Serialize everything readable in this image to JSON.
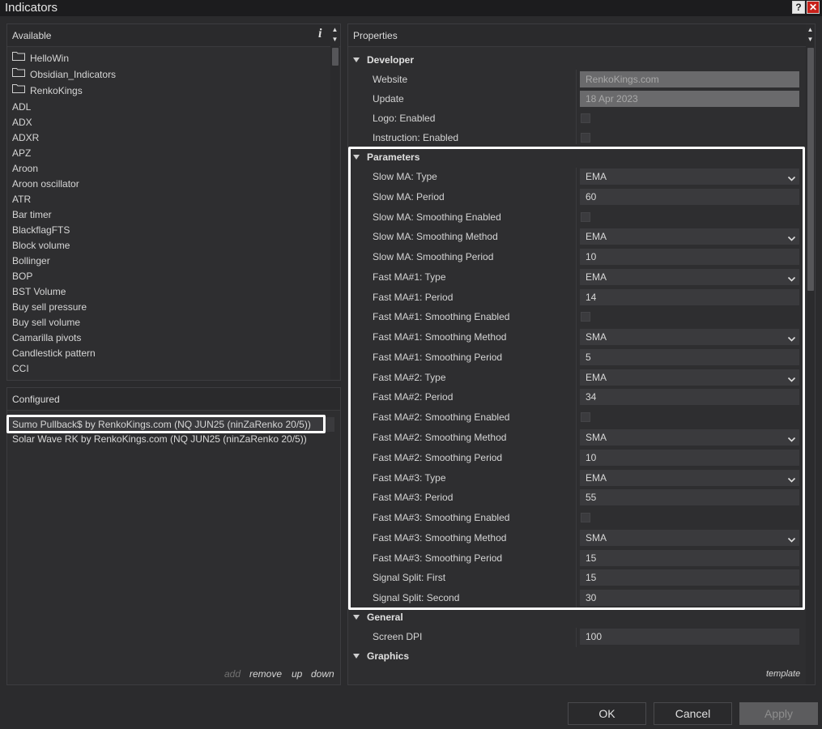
{
  "window": {
    "title": "Indicators",
    "help_icon": "?",
    "close_icon": "✕"
  },
  "available": {
    "title": "Available",
    "info_icon": "i",
    "folders": [
      "HelloWin",
      "Obsidian_Indicators",
      "RenkoKings"
    ],
    "items": [
      "ADL",
      "ADX",
      "ADXR",
      "APZ",
      "Aroon",
      "Aroon oscillator",
      "ATR",
      "Bar timer",
      "BlackflagFTS",
      "Block volume",
      "Bollinger",
      "BOP",
      "BST Volume",
      "Buy sell pressure",
      "Buy sell volume",
      "Camarilla pivots",
      "Candlestick pattern",
      "CCI"
    ]
  },
  "configured": {
    "title": "Configured",
    "items": [
      "Sumo Pullback$ by RenkoKings.com (NQ JUN25 (ninZaRenko 20/5))",
      "Solar Wave RK by RenkoKings.com (NQ JUN25 (ninZaRenko 20/5))"
    ],
    "links": {
      "add": "add",
      "remove": "remove",
      "up": "up",
      "down": "down"
    }
  },
  "properties": {
    "title": "Properties",
    "template_link": "template",
    "developer": {
      "label": "Developer",
      "website_label": "Website",
      "website_value": "RenkoKings.com",
      "update_label": "Update",
      "update_value": "18 Apr 2023",
      "logo_label": "Logo: Enabled",
      "instruction_label": "Instruction: Enabled"
    },
    "parameters": {
      "label": "Parameters",
      "rows": [
        {
          "label": "Slow MA: Type",
          "kind": "select",
          "value": "EMA"
        },
        {
          "label": "Slow MA: Period",
          "kind": "text",
          "value": "60"
        },
        {
          "label": "Slow MA: Smoothing Enabled",
          "kind": "check",
          "value": ""
        },
        {
          "label": "Slow MA: Smoothing Method",
          "kind": "select",
          "value": "EMA"
        },
        {
          "label": "Slow MA: Smoothing Period",
          "kind": "text",
          "value": "10"
        },
        {
          "label": "Fast MA#1: Type",
          "kind": "select",
          "value": "EMA"
        },
        {
          "label": "Fast MA#1: Period",
          "kind": "text",
          "value": "14"
        },
        {
          "label": "Fast MA#1: Smoothing Enabled",
          "kind": "check",
          "value": ""
        },
        {
          "label": "Fast MA#1: Smoothing Method",
          "kind": "select",
          "value": "SMA"
        },
        {
          "label": "Fast MA#1: Smoothing Period",
          "kind": "text",
          "value": "5"
        },
        {
          "label": "Fast MA#2: Type",
          "kind": "select",
          "value": "EMA"
        },
        {
          "label": "Fast MA#2: Period",
          "kind": "text",
          "value": "34"
        },
        {
          "label": "Fast MA#2: Smoothing Enabled",
          "kind": "check",
          "value": ""
        },
        {
          "label": "Fast MA#2: Smoothing Method",
          "kind": "select",
          "value": "SMA"
        },
        {
          "label": "Fast MA#2: Smoothing Period",
          "kind": "text",
          "value": "10"
        },
        {
          "label": "Fast MA#3: Type",
          "kind": "select",
          "value": "EMA"
        },
        {
          "label": "Fast MA#3: Period",
          "kind": "text",
          "value": "55"
        },
        {
          "label": "Fast MA#3: Smoothing Enabled",
          "kind": "check",
          "value": ""
        },
        {
          "label": "Fast MA#3: Smoothing Method",
          "kind": "select",
          "value": "SMA"
        },
        {
          "label": "Fast MA#3: Smoothing Period",
          "kind": "text",
          "value": "15"
        },
        {
          "label": "Signal Split: First",
          "kind": "text",
          "value": "15"
        },
        {
          "label": "Signal Split: Second",
          "kind": "text",
          "value": "30"
        }
      ]
    },
    "general": {
      "label": "General",
      "screen_dpi_label": "Screen DPI",
      "screen_dpi_value": "100"
    },
    "graphics": {
      "label": "Graphics"
    }
  },
  "buttons": {
    "ok": "OK",
    "cancel": "Cancel",
    "apply": "Apply"
  }
}
